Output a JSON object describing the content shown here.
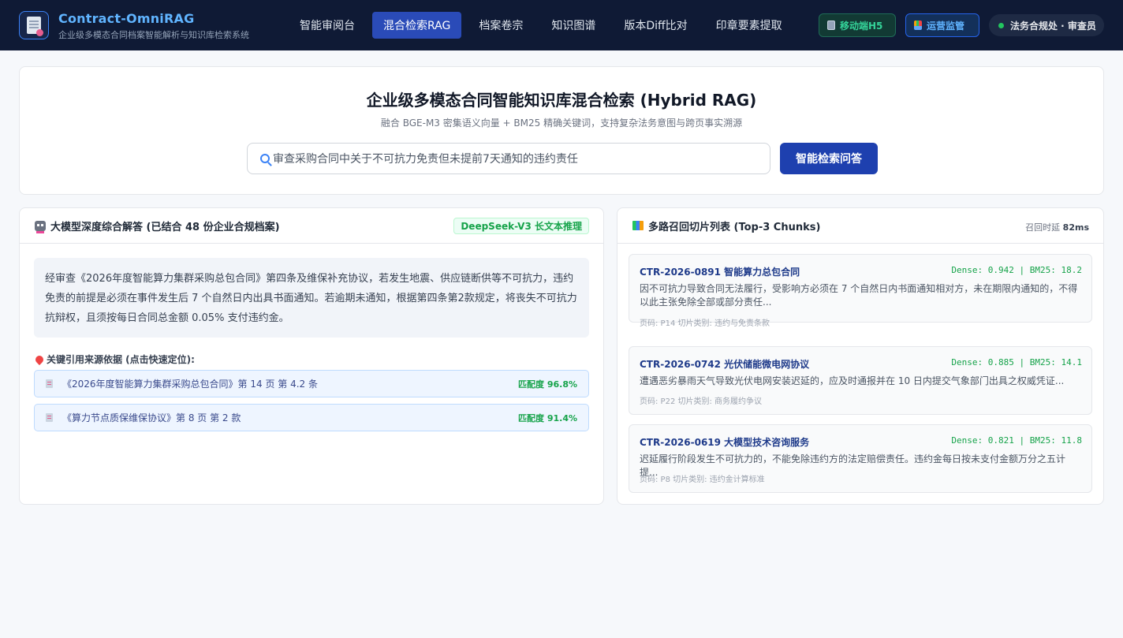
{
  "header": {
    "brand_title": "Contract-OmniRAG",
    "brand_subtitle": "企业级多模态合同档案智能解析与知识库检索系统",
    "nav": [
      {
        "label": "智能审阅台",
        "active": false
      },
      {
        "label": "混合检索RAG",
        "active": true
      },
      {
        "label": "档案卷宗",
        "active": false
      },
      {
        "label": "知识图谱",
        "active": false
      },
      {
        "label": "版本Diff比对",
        "active": false
      },
      {
        "label": "印章要素提取",
        "active": false
      }
    ],
    "mobile_btn": "移动端H5",
    "ops_btn": "运营监管",
    "user": "法务合规处 · 审查员"
  },
  "search": {
    "title": "企业级多模态合同智能知识库混合检索 (Hybrid RAG)",
    "subtitle": "融合 BGE-M3 密集语义向量 + BM25 精确关键词，支持复杂法务意图与跨页事实溯源",
    "query": "审查采购合同中关于不可抗力免责但未提前7天通知的违约责任",
    "button": "智能检索问答"
  },
  "answer_panel": {
    "title": "大模型深度综合解答 (已结合 48 份企业合规档案)",
    "model_badge": "DeepSeek-V3 长文本推理",
    "answer": "经审查《2026年度智能算力集群采购总包合同》第四条及维保补充协议，若发生地震、供应链断供等不可抗力，违约免责的前提是必须在事件发生后 7 个自然日内出具书面通知。若逾期未通知，根据第四条第2款规定，将丧失不可抗力抗辩权，且须按每日合同总金额 0.05% 支付违约金。",
    "citations_label": "关键引用来源依据 (点击快速定位):",
    "citations": [
      {
        "text": "《2026年度智能算力集群采购总包合同》第 14 页 第 4.2 条",
        "score": "匹配度 96.8%"
      },
      {
        "text": "《算力节点质保维保协议》第 8 页 第 2 款",
        "score": "匹配度 91.4%"
      }
    ]
  },
  "chunks_panel": {
    "title": "多路召回切片列表 (Top-3 Chunks)",
    "latency_label": "召回时延",
    "latency_value": "82ms",
    "chunks": [
      {
        "title": "CTR-2026-0891 智能算力总包合同",
        "score": "Dense: 0.942 | BM25: 18.2",
        "text": "因不可抗力导致合同无法履行，受影响方必须在 7 个自然日内书面通知相对方，未在期限内通知的，不得以此主张免除全部或部分责任...",
        "meta": "页码: P14    切片类别: 违约与免责条款"
      },
      {
        "title": "CTR-2026-0742 光伏储能微电网协议",
        "score": "Dense: 0.885 | BM25: 14.1",
        "text": "遭遇恶劣暴雨天气导致光伏电网安装迟延的，应及时通报并在 10 日内提交气象部门出具之权威凭证...",
        "meta": "页码: P22    切片类别: 商务履约争议"
      },
      {
        "title": "CTR-2026-0619 大模型技术咨询服务",
        "score": "Dense: 0.821 | BM25: 11.8",
        "text": "迟延履行阶段发生不可抗力的，不能免除违约方的法定赔偿责任。违约金每日按未支付金额万分之五计提...",
        "meta": "页码: P8    切片类别: 违约金计算标准"
      }
    ]
  }
}
